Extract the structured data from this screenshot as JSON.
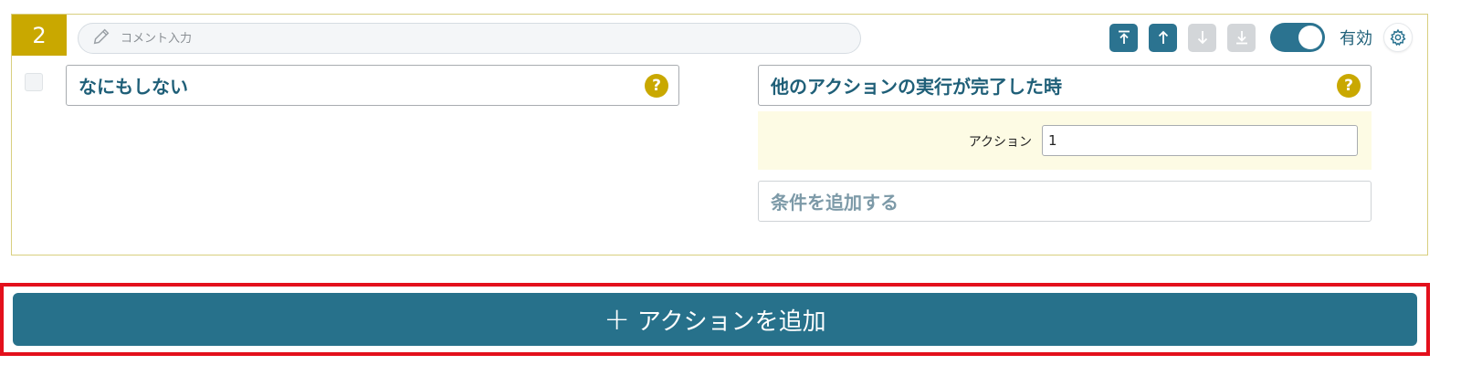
{
  "rule": {
    "number": "2",
    "comment_placeholder": "コメント入力",
    "comment_value": "",
    "enabled_label": "有効",
    "enabled": true,
    "toolbar_icons": [
      "move-top-icon",
      "move-up-icon",
      "move-down-icon",
      "move-bottom-icon",
      "gear-icon"
    ],
    "action": {
      "label": "なにもしない",
      "help": "?"
    },
    "trigger": {
      "label": "他のアクションの実行が完了した時",
      "help": "?",
      "param_label": "アクション",
      "param_value": "1"
    },
    "add_condition_label": "条件を追加する"
  },
  "add_action": {
    "plus": "+",
    "label": "アクションを追加"
  },
  "colors": {
    "accent": "#2b7390",
    "rule_badge": "#c9a800",
    "highlight_frame": "#e3101c",
    "param_background": "#fdfbe4"
  }
}
